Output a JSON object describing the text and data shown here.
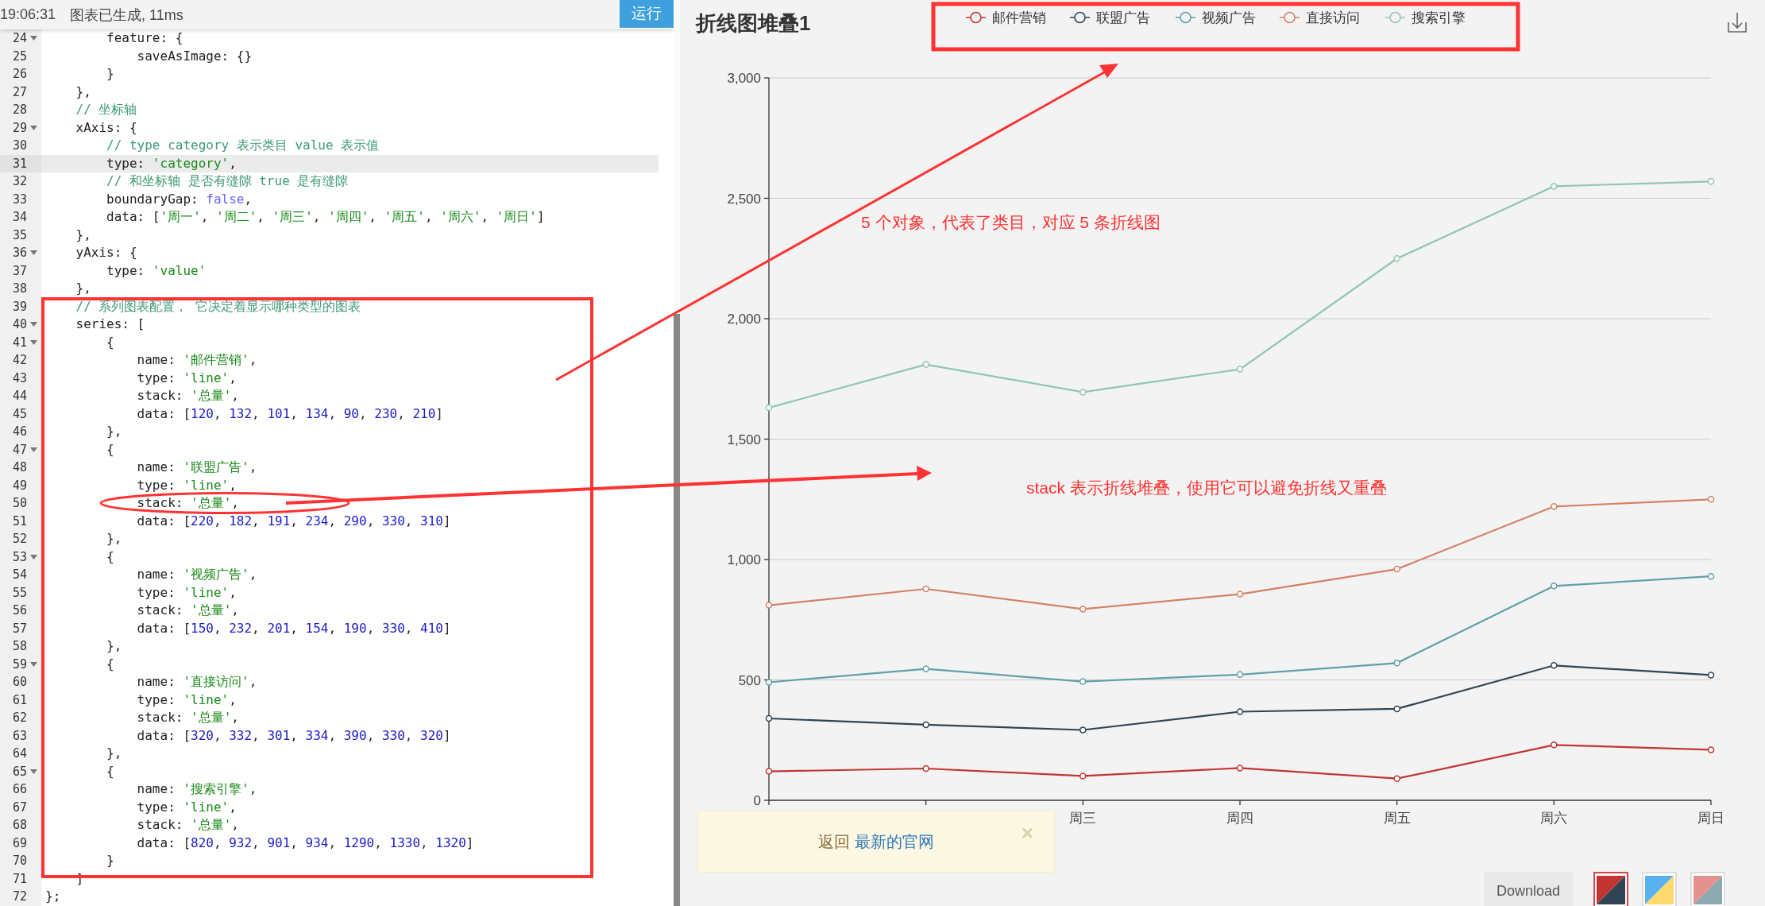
{
  "topbar": {
    "time": "19:06:31",
    "message": "图表已生成, 11ms",
    "run_button": "运行"
  },
  "editor": {
    "lines": [
      {
        "num": "24",
        "fold": true,
        "current": false,
        "tokens": [
          {
            "kind": "plain",
            "text": "        feature: {"
          }
        ]
      },
      {
        "num": "25",
        "fold": false,
        "current": false,
        "tokens": [
          {
            "kind": "plain",
            "text": "            saveAsImage: {}"
          }
        ]
      },
      {
        "num": "26",
        "fold": false,
        "current": false,
        "tokens": [
          {
            "kind": "plain",
            "text": "        }"
          }
        ]
      },
      {
        "num": "27",
        "fold": false,
        "current": false,
        "tokens": [
          {
            "kind": "plain",
            "text": "    },"
          }
        ]
      },
      {
        "num": "28",
        "fold": false,
        "current": false,
        "tokens": [
          {
            "kind": "comment",
            "text": "    // 坐标轴"
          }
        ]
      },
      {
        "num": "29",
        "fold": true,
        "current": false,
        "tokens": [
          {
            "kind": "plain",
            "text": "    xAxis: {"
          }
        ]
      },
      {
        "num": "30",
        "fold": false,
        "current": false,
        "tokens": [
          {
            "kind": "comment",
            "text": "        // type category 表示类目 value 表示值"
          }
        ]
      },
      {
        "num": "31",
        "fold": false,
        "current": true,
        "tokens": [
          {
            "kind": "plain",
            "text": "        type: "
          },
          {
            "kind": "string",
            "text": "'category'"
          },
          {
            "kind": "plain",
            "text": ","
          }
        ]
      },
      {
        "num": "32",
        "fold": false,
        "current": false,
        "tokens": [
          {
            "kind": "comment",
            "text": "        // 和坐标轴 是否有缝隙 true 是有缝隙"
          }
        ]
      },
      {
        "num": "33",
        "fold": false,
        "current": false,
        "tokens": [
          {
            "kind": "plain",
            "text": "        boundaryGap: "
          },
          {
            "kind": "keyword",
            "text": "false"
          },
          {
            "kind": "plain",
            "text": ","
          }
        ]
      },
      {
        "num": "34",
        "fold": false,
        "current": false,
        "tokens": [
          {
            "kind": "plain",
            "text": "        data: ["
          },
          {
            "kind": "string",
            "text": "'周一'"
          },
          {
            "kind": "plain",
            "text": ", "
          },
          {
            "kind": "string",
            "text": "'周二'"
          },
          {
            "kind": "plain",
            "text": ", "
          },
          {
            "kind": "string",
            "text": "'周三'"
          },
          {
            "kind": "plain",
            "text": ", "
          },
          {
            "kind": "string",
            "text": "'周四'"
          },
          {
            "kind": "plain",
            "text": ", "
          },
          {
            "kind": "string",
            "text": "'周五'"
          },
          {
            "kind": "plain",
            "text": ", "
          },
          {
            "kind": "string",
            "text": "'周六'"
          },
          {
            "kind": "plain",
            "text": ", "
          },
          {
            "kind": "string",
            "text": "'周日'"
          },
          {
            "kind": "plain",
            "text": "]"
          }
        ]
      },
      {
        "num": "35",
        "fold": false,
        "current": false,
        "tokens": [
          {
            "kind": "plain",
            "text": "    },"
          }
        ]
      },
      {
        "num": "36",
        "fold": true,
        "current": false,
        "tokens": [
          {
            "kind": "plain",
            "text": "    yAxis: {"
          }
        ]
      },
      {
        "num": "37",
        "fold": false,
        "current": false,
        "tokens": [
          {
            "kind": "plain",
            "text": "        type: "
          },
          {
            "kind": "string",
            "text": "'value'"
          }
        ]
      },
      {
        "num": "38",
        "fold": false,
        "current": false,
        "tokens": [
          {
            "kind": "plain",
            "text": "    },"
          }
        ]
      },
      {
        "num": "39",
        "fold": false,
        "current": false,
        "tokens": [
          {
            "kind": "comment",
            "text": "    // 系列图表配置， 它决定着显示哪种类型的图表"
          }
        ]
      },
      {
        "num": "40",
        "fold": true,
        "current": false,
        "tokens": [
          {
            "kind": "plain",
            "text": "    series: ["
          }
        ]
      },
      {
        "num": "41",
        "fold": true,
        "current": false,
        "tokens": [
          {
            "kind": "plain",
            "text": "        {"
          }
        ]
      },
      {
        "num": "42",
        "fold": false,
        "current": false,
        "tokens": [
          {
            "kind": "plain",
            "text": "            name: "
          },
          {
            "kind": "string",
            "text": "'邮件营销'"
          },
          {
            "kind": "plain",
            "text": ","
          }
        ]
      },
      {
        "num": "43",
        "fold": false,
        "current": false,
        "tokens": [
          {
            "kind": "plain",
            "text": "            type: "
          },
          {
            "kind": "string",
            "text": "'line'"
          },
          {
            "kind": "plain",
            "text": ","
          }
        ]
      },
      {
        "num": "44",
        "fold": false,
        "current": false,
        "tokens": [
          {
            "kind": "plain",
            "text": "            stack: "
          },
          {
            "kind": "string",
            "text": "'总量'"
          },
          {
            "kind": "plain",
            "text": ","
          }
        ]
      },
      {
        "num": "45",
        "fold": false,
        "current": false,
        "tokens": [
          {
            "kind": "plain",
            "text": "            data: ["
          },
          {
            "kind": "number",
            "text": "120"
          },
          {
            "kind": "plain",
            "text": ", "
          },
          {
            "kind": "number",
            "text": "132"
          },
          {
            "kind": "plain",
            "text": ", "
          },
          {
            "kind": "number",
            "text": "101"
          },
          {
            "kind": "plain",
            "text": ", "
          },
          {
            "kind": "number",
            "text": "134"
          },
          {
            "kind": "plain",
            "text": ", "
          },
          {
            "kind": "number",
            "text": "90"
          },
          {
            "kind": "plain",
            "text": ", "
          },
          {
            "kind": "number",
            "text": "230"
          },
          {
            "kind": "plain",
            "text": ", "
          },
          {
            "kind": "number",
            "text": "210"
          },
          {
            "kind": "plain",
            "text": "]"
          }
        ]
      },
      {
        "num": "46",
        "fold": false,
        "current": false,
        "tokens": [
          {
            "kind": "plain",
            "text": "        },"
          }
        ]
      },
      {
        "num": "47",
        "fold": true,
        "current": false,
        "tokens": [
          {
            "kind": "plain",
            "text": "        {"
          }
        ]
      },
      {
        "num": "48",
        "fold": false,
        "current": false,
        "tokens": [
          {
            "kind": "plain",
            "text": "            name: "
          },
          {
            "kind": "string",
            "text": "'联盟广告'"
          },
          {
            "kind": "plain",
            "text": ","
          }
        ]
      },
      {
        "num": "49",
        "fold": false,
        "current": false,
        "tokens": [
          {
            "kind": "plain",
            "text": "            type: "
          },
          {
            "kind": "string",
            "text": "'line'"
          },
          {
            "kind": "plain",
            "text": ","
          }
        ]
      },
      {
        "num": "50",
        "fold": false,
        "current": false,
        "tokens": [
          {
            "kind": "plain",
            "text": "            stack: "
          },
          {
            "kind": "string",
            "text": "'总量'"
          },
          {
            "kind": "plain",
            "text": ","
          }
        ]
      },
      {
        "num": "51",
        "fold": false,
        "current": false,
        "tokens": [
          {
            "kind": "plain",
            "text": "            data: ["
          },
          {
            "kind": "number",
            "text": "220"
          },
          {
            "kind": "plain",
            "text": ", "
          },
          {
            "kind": "number",
            "text": "182"
          },
          {
            "kind": "plain",
            "text": ", "
          },
          {
            "kind": "number",
            "text": "191"
          },
          {
            "kind": "plain",
            "text": ", "
          },
          {
            "kind": "number",
            "text": "234"
          },
          {
            "kind": "plain",
            "text": ", "
          },
          {
            "kind": "number",
            "text": "290"
          },
          {
            "kind": "plain",
            "text": ", "
          },
          {
            "kind": "number",
            "text": "330"
          },
          {
            "kind": "plain",
            "text": ", "
          },
          {
            "kind": "number",
            "text": "310"
          },
          {
            "kind": "plain",
            "text": "]"
          }
        ]
      },
      {
        "num": "52",
        "fold": false,
        "current": false,
        "tokens": [
          {
            "kind": "plain",
            "text": "        },"
          }
        ]
      },
      {
        "num": "53",
        "fold": true,
        "current": false,
        "tokens": [
          {
            "kind": "plain",
            "text": "        {"
          }
        ]
      },
      {
        "num": "54",
        "fold": false,
        "current": false,
        "tokens": [
          {
            "kind": "plain",
            "text": "            name: "
          },
          {
            "kind": "string",
            "text": "'视频广告'"
          },
          {
            "kind": "plain",
            "text": ","
          }
        ]
      },
      {
        "num": "55",
        "fold": false,
        "current": false,
        "tokens": [
          {
            "kind": "plain",
            "text": "            type: "
          },
          {
            "kind": "string",
            "text": "'line'"
          },
          {
            "kind": "plain",
            "text": ","
          }
        ]
      },
      {
        "num": "56",
        "fold": false,
        "current": false,
        "tokens": [
          {
            "kind": "plain",
            "text": "            stack: "
          },
          {
            "kind": "string",
            "text": "'总量'"
          },
          {
            "kind": "plain",
            "text": ","
          }
        ]
      },
      {
        "num": "57",
        "fold": false,
        "current": false,
        "tokens": [
          {
            "kind": "plain",
            "text": "            data: ["
          },
          {
            "kind": "number",
            "text": "150"
          },
          {
            "kind": "plain",
            "text": ", "
          },
          {
            "kind": "number",
            "text": "232"
          },
          {
            "kind": "plain",
            "text": ", "
          },
          {
            "kind": "number",
            "text": "201"
          },
          {
            "kind": "plain",
            "text": ", "
          },
          {
            "kind": "number",
            "text": "154"
          },
          {
            "kind": "plain",
            "text": ", "
          },
          {
            "kind": "number",
            "text": "190"
          },
          {
            "kind": "plain",
            "text": ", "
          },
          {
            "kind": "number",
            "text": "330"
          },
          {
            "kind": "plain",
            "text": ", "
          },
          {
            "kind": "number",
            "text": "410"
          },
          {
            "kind": "plain",
            "text": "]"
          }
        ]
      },
      {
        "num": "58",
        "fold": false,
        "current": false,
        "tokens": [
          {
            "kind": "plain",
            "text": "        },"
          }
        ]
      },
      {
        "num": "59",
        "fold": true,
        "current": false,
        "tokens": [
          {
            "kind": "plain",
            "text": "        {"
          }
        ]
      },
      {
        "num": "60",
        "fold": false,
        "current": false,
        "tokens": [
          {
            "kind": "plain",
            "text": "            name: "
          },
          {
            "kind": "string",
            "text": "'直接访问'"
          },
          {
            "kind": "plain",
            "text": ","
          }
        ]
      },
      {
        "num": "61",
        "fold": false,
        "current": false,
        "tokens": [
          {
            "kind": "plain",
            "text": "            type: "
          },
          {
            "kind": "string",
            "text": "'line'"
          },
          {
            "kind": "plain",
            "text": ","
          }
        ]
      },
      {
        "num": "62",
        "fold": false,
        "current": false,
        "tokens": [
          {
            "kind": "plain",
            "text": "            stack: "
          },
          {
            "kind": "string",
            "text": "'总量'"
          },
          {
            "kind": "plain",
            "text": ","
          }
        ]
      },
      {
        "num": "63",
        "fold": false,
        "current": false,
        "tokens": [
          {
            "kind": "plain",
            "text": "            data: ["
          },
          {
            "kind": "number",
            "text": "320"
          },
          {
            "kind": "plain",
            "text": ", "
          },
          {
            "kind": "number",
            "text": "332"
          },
          {
            "kind": "plain",
            "text": ", "
          },
          {
            "kind": "number",
            "text": "301"
          },
          {
            "kind": "plain",
            "text": ", "
          },
          {
            "kind": "number",
            "text": "334"
          },
          {
            "kind": "plain",
            "text": ", "
          },
          {
            "kind": "number",
            "text": "390"
          },
          {
            "kind": "plain",
            "text": ", "
          },
          {
            "kind": "number",
            "text": "330"
          },
          {
            "kind": "plain",
            "text": ", "
          },
          {
            "kind": "number",
            "text": "320"
          },
          {
            "kind": "plain",
            "text": "]"
          }
        ]
      },
      {
        "num": "64",
        "fold": false,
        "current": false,
        "tokens": [
          {
            "kind": "plain",
            "text": "        },"
          }
        ]
      },
      {
        "num": "65",
        "fold": true,
        "current": false,
        "tokens": [
          {
            "kind": "plain",
            "text": "        {"
          }
        ]
      },
      {
        "num": "66",
        "fold": false,
        "current": false,
        "tokens": [
          {
            "kind": "plain",
            "text": "            name: "
          },
          {
            "kind": "string",
            "text": "'搜索引擎'"
          },
          {
            "kind": "plain",
            "text": ","
          }
        ]
      },
      {
        "num": "67",
        "fold": false,
        "current": false,
        "tokens": [
          {
            "kind": "plain",
            "text": "            type: "
          },
          {
            "kind": "string",
            "text": "'line'"
          },
          {
            "kind": "plain",
            "text": ","
          }
        ]
      },
      {
        "num": "68",
        "fold": false,
        "current": false,
        "tokens": [
          {
            "kind": "plain",
            "text": "            stack: "
          },
          {
            "kind": "string",
            "text": "'总量'"
          },
          {
            "kind": "plain",
            "text": ","
          }
        ]
      },
      {
        "num": "69",
        "fold": false,
        "current": false,
        "tokens": [
          {
            "kind": "plain",
            "text": "            data: ["
          },
          {
            "kind": "number",
            "text": "820"
          },
          {
            "kind": "plain",
            "text": ", "
          },
          {
            "kind": "number",
            "text": "932"
          },
          {
            "kind": "plain",
            "text": ", "
          },
          {
            "kind": "number",
            "text": "901"
          },
          {
            "kind": "plain",
            "text": ", "
          },
          {
            "kind": "number",
            "text": "934"
          },
          {
            "kind": "plain",
            "text": ", "
          },
          {
            "kind": "number",
            "text": "1290"
          },
          {
            "kind": "plain",
            "text": ", "
          },
          {
            "kind": "number",
            "text": "1330"
          },
          {
            "kind": "plain",
            "text": ", "
          },
          {
            "kind": "number",
            "text": "1320"
          },
          {
            "kind": "plain",
            "text": "]"
          }
        ]
      },
      {
        "num": "70",
        "fold": false,
        "current": false,
        "tokens": [
          {
            "kind": "plain",
            "text": "        }"
          }
        ]
      },
      {
        "num": "71",
        "fold": false,
        "current": false,
        "tokens": [
          {
            "kind": "plain",
            "text": "    ]"
          }
        ]
      },
      {
        "num": "72",
        "fold": false,
        "current": false,
        "tokens": [
          {
            "kind": "plain",
            "text": "};"
          }
        ]
      }
    ]
  },
  "chart": {
    "chart_data": {
      "type": "line",
      "title": "折线图堆叠1",
      "grid": true,
      "legend": "top",
      "categories": [
        null,
        null,
        "周三",
        "周四",
        "周五",
        "周六",
        "周日"
      ],
      "ylim": [
        0,
        3000
      ],
      "yticks": [
        {
          "value": 0,
          "label": "0"
        },
        {
          "value": 500,
          "label": "500"
        },
        {
          "value": 1000,
          "label": "1,000"
        },
        {
          "value": 1500,
          "label": "1,500"
        },
        {
          "value": 2000,
          "label": "2,000"
        },
        {
          "value": 2500,
          "label": "2,500"
        },
        {
          "value": 3000,
          "label": "3,000"
        }
      ],
      "series": [
        {
          "name": "邮件营销",
          "color": "#c23531",
          "marker": "circle",
          "values": [
            120,
            132,
            101,
            134,
            90,
            230,
            210
          ]
        },
        {
          "name": "联盟广告",
          "color": "#2f4554",
          "marker": "circle",
          "values": [
            340,
            314,
            292,
            368,
            380,
            560,
            520
          ]
        },
        {
          "name": "视频广告",
          "color": "#61a0a8",
          "marker": "circle",
          "values": [
            490,
            546,
            493,
            522,
            570,
            890,
            930
          ]
        },
        {
          "name": "直接访问",
          "color": "#d48265",
          "marker": "circle",
          "values": [
            810,
            878,
            794,
            856,
            960,
            1220,
            1250
          ]
        },
        {
          "name": "搜索引擎",
          "color": "#91c7ae",
          "marker": "circle",
          "values": [
            1630,
            1810,
            1695,
            1790,
            2250,
            2550,
            2570
          ]
        }
      ]
    }
  },
  "notice": {
    "prefix": "返回",
    "link": "最新的官网",
    "close": "×"
  },
  "footer": {
    "download_button": "Download",
    "themes": [
      {
        "selected": true
      },
      {
        "selected": false
      },
      {
        "selected": false
      }
    ]
  },
  "annotations": {
    "notes": [
      {
        "text": "5 个对象，代表了类目，对应 5 条折线图"
      },
      {
        "text": "stack 表示折线堆叠，使用它可以避免折线又重叠"
      }
    ]
  }
}
